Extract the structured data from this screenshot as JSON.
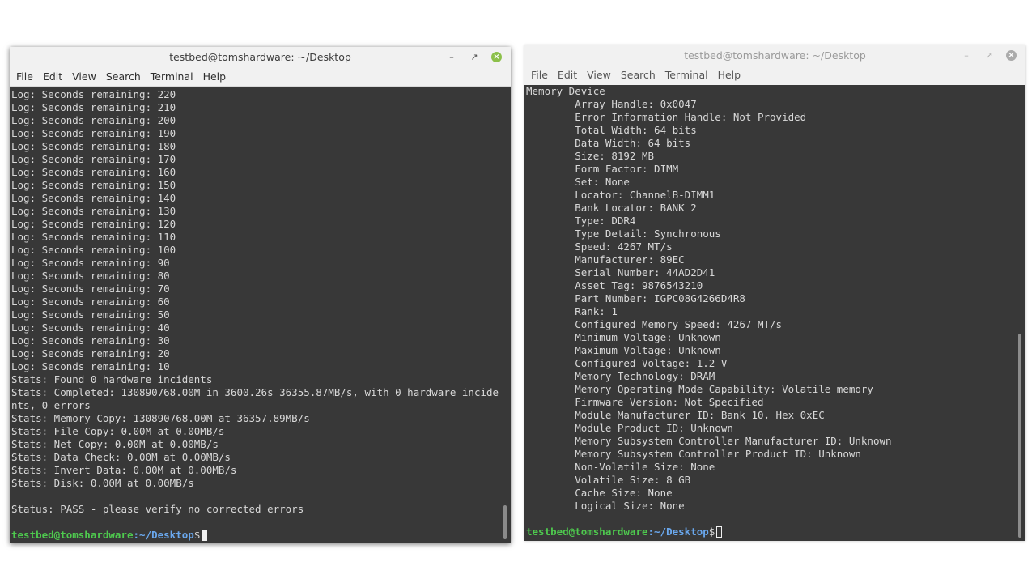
{
  "left_window": {
    "title": "testbed@tomshardware: ~/Desktop",
    "menu": [
      "File",
      "Edit",
      "View",
      "Search",
      "Terminal",
      "Help"
    ],
    "output": [
      "Log: Seconds remaining: 220",
      "Log: Seconds remaining: 210",
      "Log: Seconds remaining: 200",
      "Log: Seconds remaining: 190",
      "Log: Seconds remaining: 180",
      "Log: Seconds remaining: 170",
      "Log: Seconds remaining: 160",
      "Log: Seconds remaining: 150",
      "Log: Seconds remaining: 140",
      "Log: Seconds remaining: 130",
      "Log: Seconds remaining: 120",
      "Log: Seconds remaining: 110",
      "Log: Seconds remaining: 100",
      "Log: Seconds remaining: 90",
      "Log: Seconds remaining: 80",
      "Log: Seconds remaining: 70",
      "Log: Seconds remaining: 60",
      "Log: Seconds remaining: 50",
      "Log: Seconds remaining: 40",
      "Log: Seconds remaining: 30",
      "Log: Seconds remaining: 20",
      "Log: Seconds remaining: 10",
      "Stats: Found 0 hardware incidents",
      "Stats: Completed: 130890768.00M in 3600.26s 36355.87MB/s, with 0 hardware incide",
      "nts, 0 errors",
      "Stats: Memory Copy: 130890768.00M at 36357.89MB/s",
      "Stats: File Copy: 0.00M at 0.00MB/s",
      "Stats: Net Copy: 0.00M at 0.00MB/s",
      "Stats: Data Check: 0.00M at 0.00MB/s",
      "Stats: Invert Data: 0.00M at 0.00MB/s",
      "Stats: Disk: 0.00M at 0.00MB/s",
      "",
      "Status: PASS - please verify no corrected errors",
      ""
    ],
    "prompt_user": "testbed@tomshardware",
    "prompt_path": ":~/Desktop",
    "prompt_symbol": "$"
  },
  "right_window": {
    "title": "testbed@tomshardware: ~/Desktop",
    "menu": [
      "File",
      "Edit",
      "View",
      "Search",
      "Terminal",
      "Help"
    ],
    "output": [
      "Memory Device",
      "\tArray Handle: 0x0047",
      "\tError Information Handle: Not Provided",
      "\tTotal Width: 64 bits",
      "\tData Width: 64 bits",
      "\tSize: 8192 MB",
      "\tForm Factor: DIMM",
      "\tSet: None",
      "\tLocator: ChannelB-DIMM1",
      "\tBank Locator: BANK 2",
      "\tType: DDR4",
      "\tType Detail: Synchronous",
      "\tSpeed: 4267 MT/s",
      "\tManufacturer: 89EC",
      "\tSerial Number: 44AD2D41",
      "\tAsset Tag: 9876543210",
      "\tPart Number: IGPC08G4266D4R8",
      "\tRank: 1",
      "\tConfigured Memory Speed: 4267 MT/s",
      "\tMinimum Voltage: Unknown",
      "\tMaximum Voltage: Unknown",
      "\tConfigured Voltage: 1.2 V",
      "\tMemory Technology: DRAM",
      "\tMemory Operating Mode Capability: Volatile memory",
      "\tFirmware Version: Not Specified",
      "\tModule Manufacturer ID: Bank 10, Hex 0xEC",
      "\tModule Product ID: Unknown",
      "\tMemory Subsystem Controller Manufacturer ID: Unknown",
      "\tMemory Subsystem Controller Product ID: Unknown",
      "\tNon-Volatile Size: None",
      "\tVolatile Size: 8 GB",
      "\tCache Size: None",
      "\tLogical Size: None",
      ""
    ],
    "prompt_user": "testbed@tomshardware",
    "prompt_path": ":~/Desktop",
    "prompt_symbol": "$"
  },
  "icons": {
    "minimize": "minimize-icon",
    "maximize": "maximize-icon",
    "close": "close-icon"
  }
}
